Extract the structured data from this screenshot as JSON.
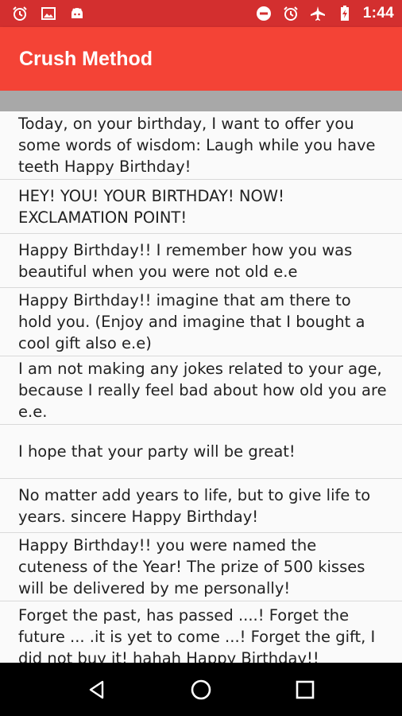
{
  "status_bar": {
    "time": "1:44",
    "left_icons": [
      "alarm-clock-icon",
      "image-icon",
      "android-icon"
    ],
    "right_icons": [
      "do-not-disturb-icon",
      "alarm-icon",
      "airplane-mode-icon",
      "battery-charging-icon"
    ]
  },
  "app_bar": {
    "title": "Crush Method",
    "color": "#f44336"
  },
  "messages": [
    "Today, on your birthday, I want to offer you some words of wisdom: Laugh while you have teeth Happy Birthday!",
    "HEY! YOU! YOUR BIRTHDAY! NOW! EXCLAMATION POINT!",
    "Happy Birthday!! I remember how you was beautiful when you were not old e.e",
    "Happy Birthday!! imagine that am there to hold you. (Enjoy and imagine that I bought a cool gift also e.e)",
    "I am not making any jokes related to your age, because I really feel bad about how old you are e.e.",
    "I hope that your party will be great!",
    "No matter add years to life, but to give life to years. sincere Happy Birthday!",
    "Happy Birthday!! you were named the cuteness of the Year! The prize of 500 kisses will be delivered by me personally!",
    "Forget the past, has passed ....! Forget the future ... .it is yet to come ...! Forget the gift, I did not buy it! hahah Happy Birthday!!"
  ],
  "nav_bar": {
    "buttons": [
      "back-icon",
      "home-icon",
      "recents-icon"
    ]
  }
}
